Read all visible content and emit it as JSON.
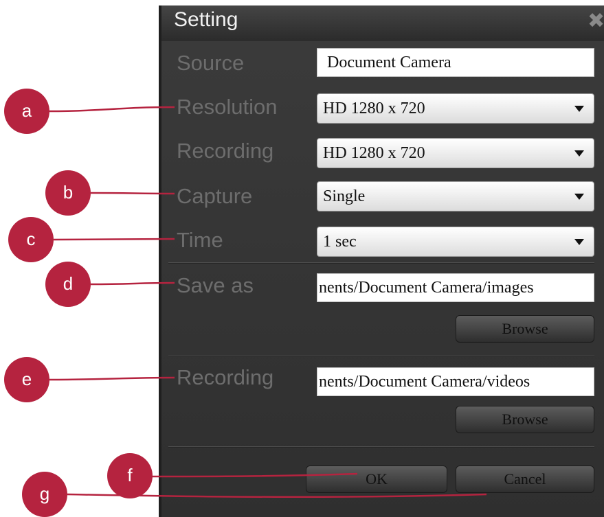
{
  "dialog": {
    "title": "Setting",
    "close_icon": "close-icon",
    "fields": {
      "source": {
        "label": "Source",
        "value": "Document Camera"
      },
      "resolution": {
        "label": "Resolution",
        "value": "HD 1280 x 720"
      },
      "recording_resolution": {
        "label": "Recording",
        "value": "HD 1280 x 720"
      },
      "capture": {
        "label": "Capture",
        "value": "Single"
      },
      "time": {
        "label": "Time",
        "value": "1 sec"
      },
      "save_as": {
        "label": "Save as",
        "value": "nents/Document Camera/images",
        "browse_label": "Browse"
      },
      "recording_path": {
        "label": "Recording",
        "value": "nents/Document Camera/videos",
        "browse_label": "Browse"
      }
    },
    "ok_label": "OK",
    "cancel_label": "Cancel"
  },
  "callouts": {
    "a": "a",
    "b": "b",
    "c": "c",
    "d": "d",
    "e": "e",
    "f": "f",
    "g": "g"
  },
  "colors": {
    "callout": "#b5233f",
    "dialog_bg": "#333333",
    "label_text": "#6d6d6d"
  }
}
